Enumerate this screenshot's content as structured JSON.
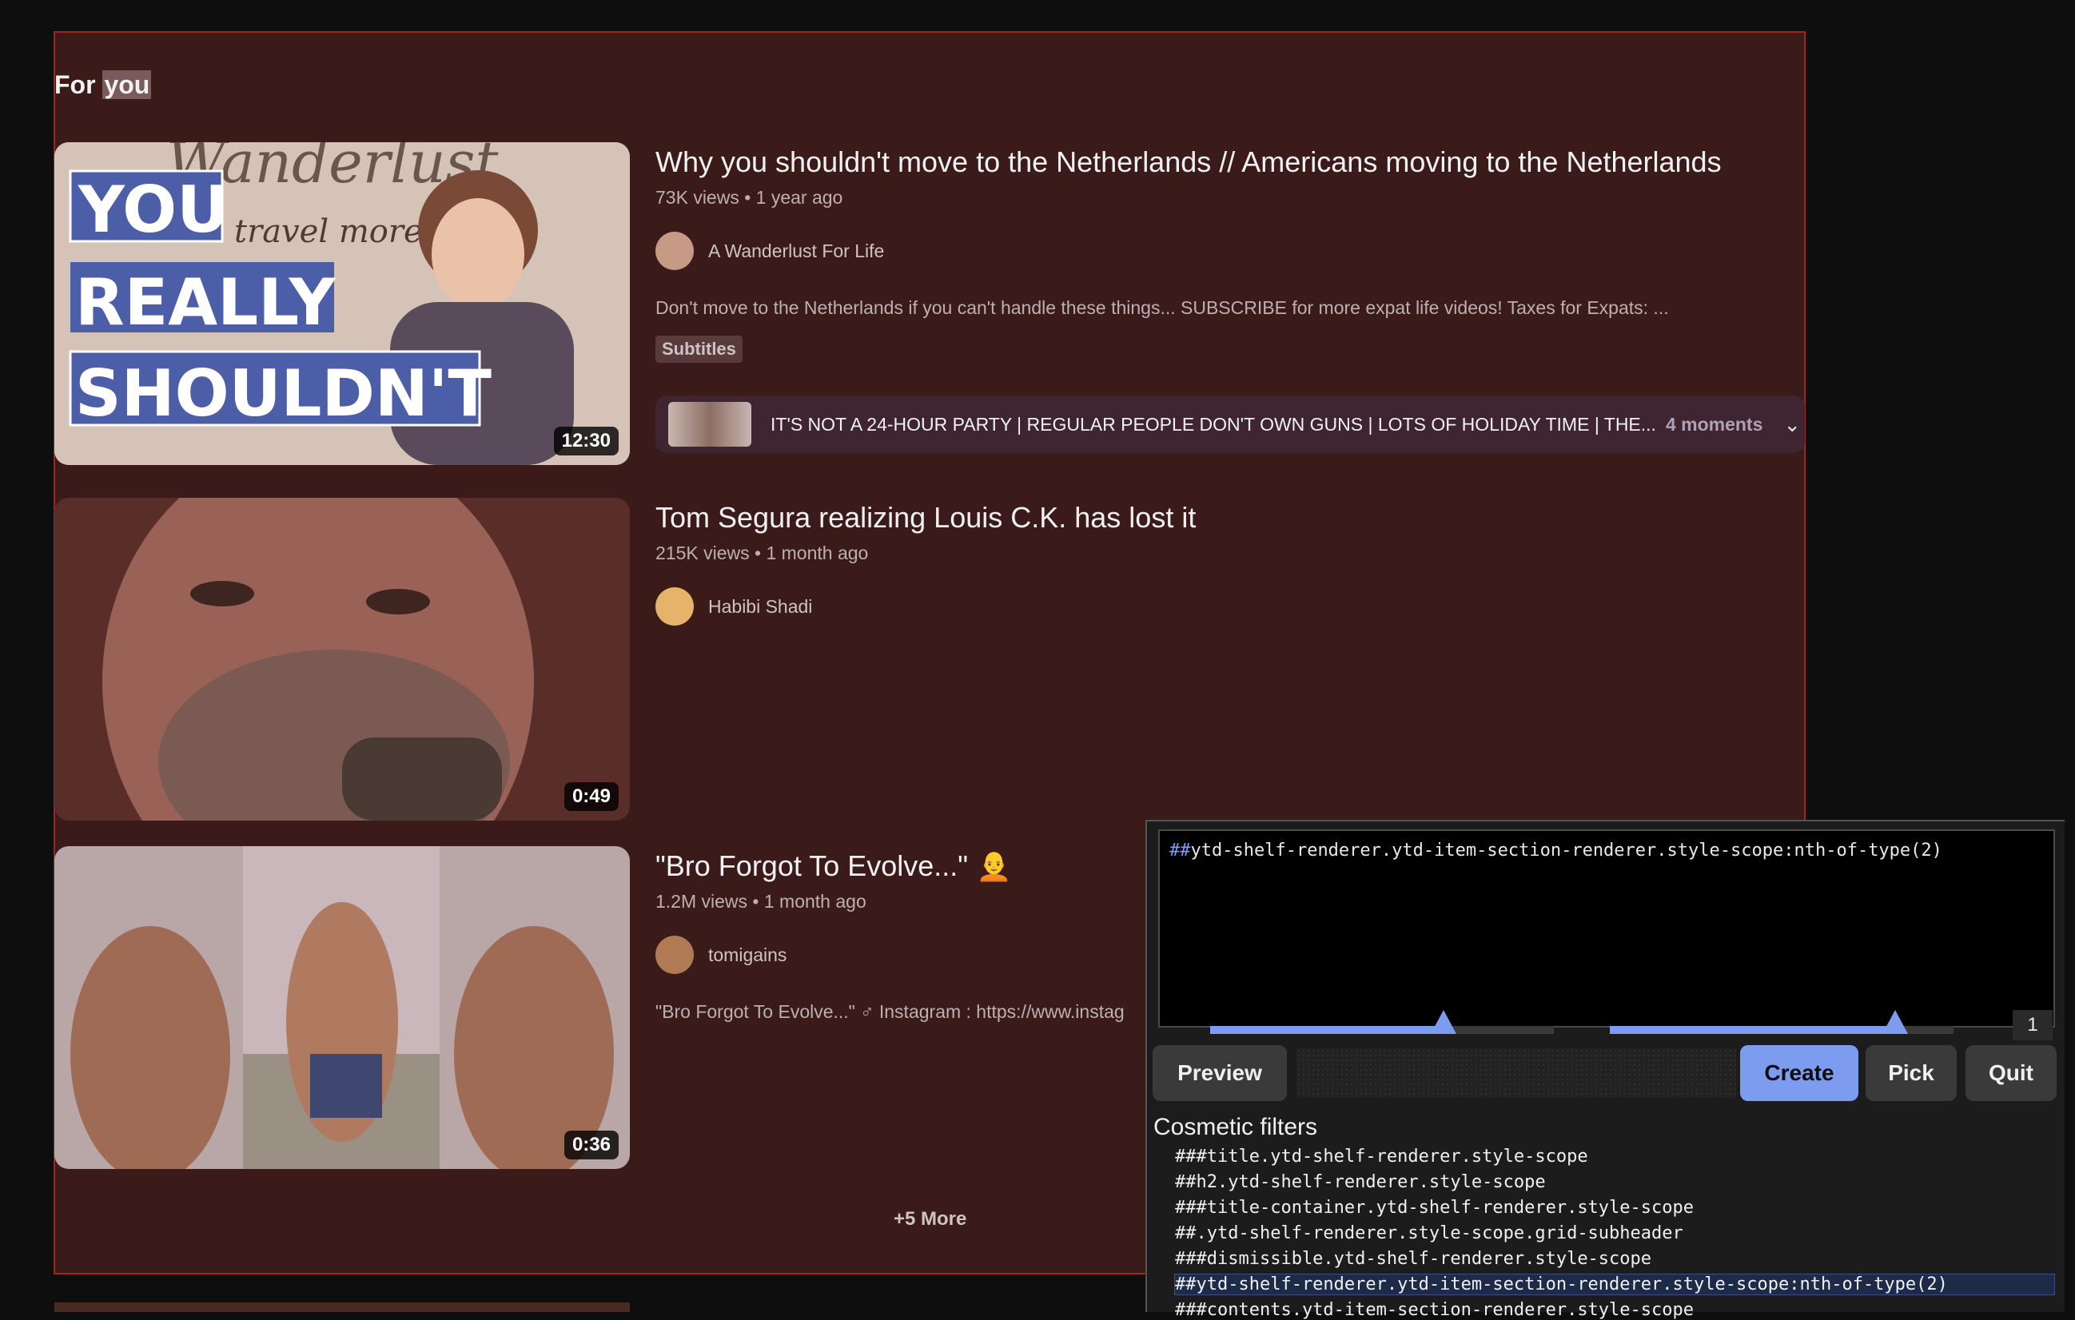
{
  "shelf": {
    "title_prefix": "For ",
    "title_highlight": "you",
    "more_label": "+5 More"
  },
  "videos": [
    {
      "title": "Why you shouldn't move to the Netherlands // Americans moving to the Netherlands",
      "meta": "73K views • 1 year ago",
      "channel": "A Wanderlust For Life",
      "description": "Don't move to the Netherlands if you can't handle these things... SUBSCRIBE for more expat life videos! Taxes for Expats: ...",
      "badge": "Subtitles",
      "duration": "12:30",
      "thumb_text": [
        "YOU",
        "REALLY",
        "SHOULDN'T"
      ],
      "thumb_script": "Wanderlust",
      "thumb_script2": "travel more!",
      "chapters_text": "IT'S NOT A 24-HOUR PARTY | REGULAR PEOPLE DON'T OWN GUNS | LOTS OF HOLIDAY TIME | THE...",
      "chapters_count": "4 moments"
    },
    {
      "title": "Tom Segura realizing Louis C.K. has lost it",
      "meta": "215K views • 1 month ago",
      "channel": "Habibi Shadi",
      "duration": "0:49"
    },
    {
      "title": "\"Bro Forgot To Evolve...\" 🧑‍🦲",
      "meta": "1.2M views • 1 month ago",
      "channel": "tomigains",
      "description": "\"Bro Forgot To Evolve...\" ♂ Instagram : https://www.instag",
      "duration": "0:36"
    }
  ],
  "picker": {
    "filter_hash": "##",
    "filter_text": "ytd-shelf-renderer.ytd-item-section-renderer.style-scope:nth-of-type(2)",
    "match_count": "1",
    "slider1_level": 0.68,
    "slider2_level": 0.83,
    "buttons": {
      "preview": "Preview",
      "create": "Create",
      "pick": "Pick",
      "quit": "Quit"
    },
    "cosmetic_title": "Cosmetic filters",
    "cosmetic_filters": [
      "###title.ytd-shelf-renderer.style-scope",
      "##h2.ytd-shelf-renderer.style-scope",
      "###title-container.ytd-shelf-renderer.style-scope",
      "##.ytd-shelf-renderer.style-scope.grid-subheader",
      "###dismissible.ytd-shelf-renderer.style-scope",
      "##ytd-shelf-renderer.ytd-item-section-renderer.style-scope:nth-of-type(2)",
      "###contents.ytd-item-section-renderer.style-scope"
    ]
  }
}
